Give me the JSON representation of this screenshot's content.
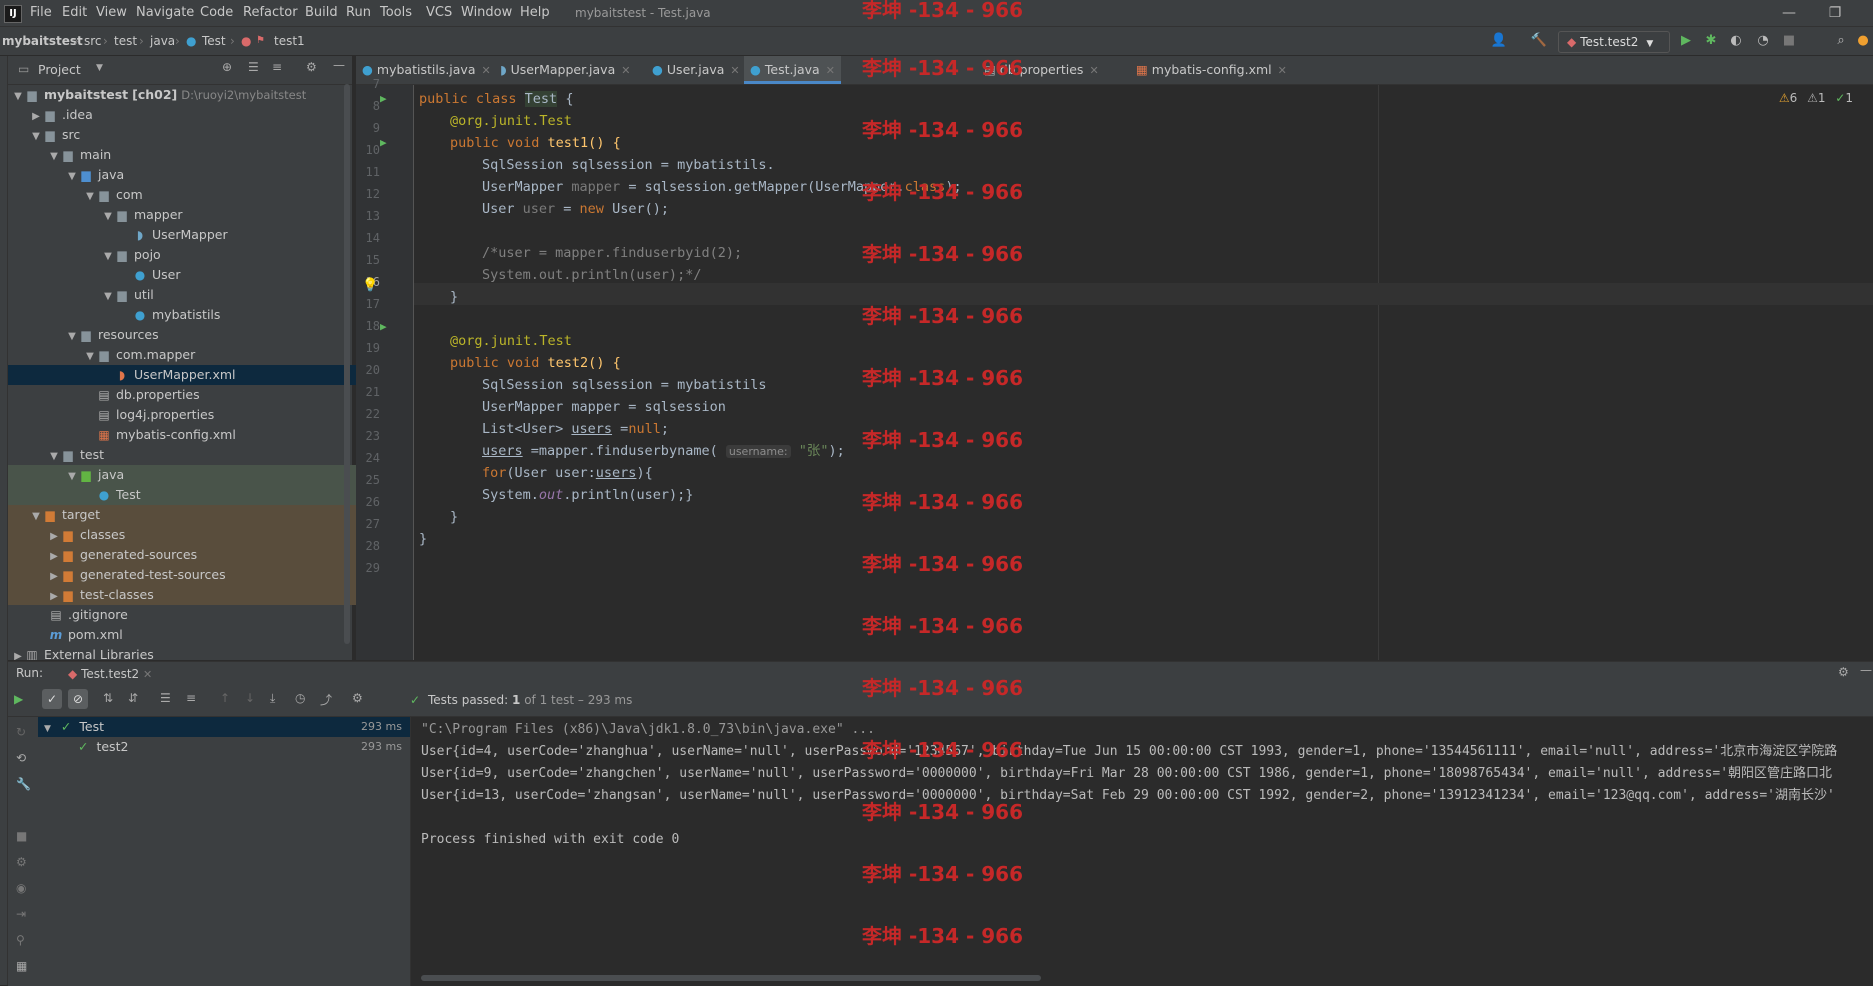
{
  "menubar": {
    "app_icon": "IJ",
    "items": [
      "File",
      "Edit",
      "View",
      "Navigate",
      "Code",
      "Refactor",
      "Build",
      "Run",
      "Tools",
      "VCS",
      "Window",
      "Help"
    ],
    "window_title": "mybaitstest - Test.java",
    "minimize": "—",
    "maximize": "❐"
  },
  "navbar": {
    "crumbs": [
      "mybaitstest",
      "src",
      "test",
      "java",
      "Test",
      "test1"
    ],
    "run_config": "Test.test2"
  },
  "project": {
    "title": "Project",
    "tree": [
      {
        "label": "mybaitstest",
        "suffix": "[ch02]",
        "path": "D:\\ruoyi2\\mybaitstest"
      },
      {
        "label": ".idea"
      },
      {
        "label": "src"
      },
      {
        "label": "main"
      },
      {
        "label": "java"
      },
      {
        "label": "com"
      },
      {
        "label": "mapper"
      },
      {
        "label": "UserMapper"
      },
      {
        "label": "pojo"
      },
      {
        "label": "User"
      },
      {
        "label": "util"
      },
      {
        "label": "mybatistils"
      },
      {
        "label": "resources"
      },
      {
        "label": "com.mapper"
      },
      {
        "label": "UserMapper.xml"
      },
      {
        "label": "db.properties"
      },
      {
        "label": "log4j.properties"
      },
      {
        "label": "mybatis-config.xml"
      },
      {
        "label": "test"
      },
      {
        "label": "java"
      },
      {
        "label": "Test"
      },
      {
        "label": "target"
      },
      {
        "label": "classes"
      },
      {
        "label": "generated-sources"
      },
      {
        "label": "generated-test-sources"
      },
      {
        "label": "test-classes"
      },
      {
        "label": ".gitignore"
      },
      {
        "label": "pom.xml"
      },
      {
        "label": "External Libraries"
      }
    ]
  },
  "tabs": [
    {
      "label": "mybatistils.java"
    },
    {
      "label": "UserMapper.java"
    },
    {
      "label": "User.java"
    },
    {
      "label": "Test.java"
    },
    {
      "label": "db.properties"
    },
    {
      "label": "mybatis-config.xml"
    }
  ],
  "editor": {
    "inspection": {
      "warnings": "6",
      "weak": "1",
      "ok": "1"
    },
    "line_numbers": [
      "7",
      "8",
      "9",
      "10",
      "11",
      "12",
      "13",
      "14",
      "15",
      "16",
      "17",
      "18",
      "19",
      "20",
      "21",
      "22",
      "23",
      "24",
      "25",
      "26",
      "27",
      "28",
      "29"
    ],
    "code": {
      "l8_kw": "public class ",
      "l8_cls": "Test",
      "l8_rest": " {",
      "l9": "@org.junit.Test",
      "l10_kw": "public void ",
      "l10_rest": "test1() {",
      "l11": "SqlSession sqlsession = mybatistils.",
      "l12_a": "UserMapper ",
      "l12_b": "mapper",
      "l12_c": " = sqlsession.getMapper(UserMapper.",
      "l12_d": "class",
      "l12_e": ");",
      "l13_a": "User ",
      "l13_b": "user",
      "l13_c": " = ",
      "l13_d": "new",
      "l13_e": " User();",
      "l15": "/*user = mapper.finduserbyid(2);",
      "l16": "System.out.println(user);*/",
      "l17": "}",
      "l19": "@org.junit.Test",
      "l20_kw": "public void ",
      "l20_rest": "test2() {",
      "l21": "SqlSession sqlsession = mybatistils",
      "l22": "UserMapper mapper = sqlsession",
      "l23_a": "List<User> ",
      "l23_b": "users",
      "l23_c": " =",
      "l23_d": "null",
      "l23_e": ";",
      "l24_a": "users",
      "l24_b": " =mapper.finduserbyname( ",
      "l24_hint": "username:",
      "l24_c": " ",
      "l24_str": "\"张\"",
      "l24_d": ");",
      "l25_a": "for",
      "l25_b": "(User user:",
      "l25_c": "users",
      "l25_d": "){",
      "l26_a": "System.",
      "l26_b": "out",
      "l26_c": ".println(user);}",
      "l27": "}",
      "l28": "}"
    }
  },
  "run": {
    "label": "Run:",
    "tab": "Test.test2",
    "status_prefix": "Tests passed: ",
    "status_count": "1",
    "status_rest": " of 1 test – 293 ms",
    "tree": [
      {
        "label": "Test",
        "time": "293 ms"
      },
      {
        "label": "test2",
        "time": "293 ms"
      }
    ],
    "console": [
      "\"C:\\Program Files (x86)\\Java\\jdk1.8.0_73\\bin\\java.exe\" ...",
      "User{id=4, userCode='zhanghua', userName='null', userPassword='1234567', birthday=Tue Jun 15 00:00:00 CST 1993, gender=1, phone='13544561111', email='null', address='北京市海淀区学院路",
      "User{id=9, userCode='zhangchen', userName='null', userPassword='0000000', birthday=Fri Mar 28 00:00:00 CST 1986, gender=1, phone='18098765434', email='null', address='朝阳区管庄路口北",
      "User{id=13, userCode='zhangsan', userName='null', userPassword='0000000', birthday=Sat Feb 29 00:00:00 CST 1992, gender=2, phone='13912341234', email='123@qq.com', address='湖南长沙'",
      "",
      "Process finished with exit code 0"
    ]
  },
  "watermark": "李坤 -134 - 966",
  "colors": {
    "accent": "#4a88c7",
    "pass": "#5fb85f",
    "watermark": "#c62828"
  }
}
